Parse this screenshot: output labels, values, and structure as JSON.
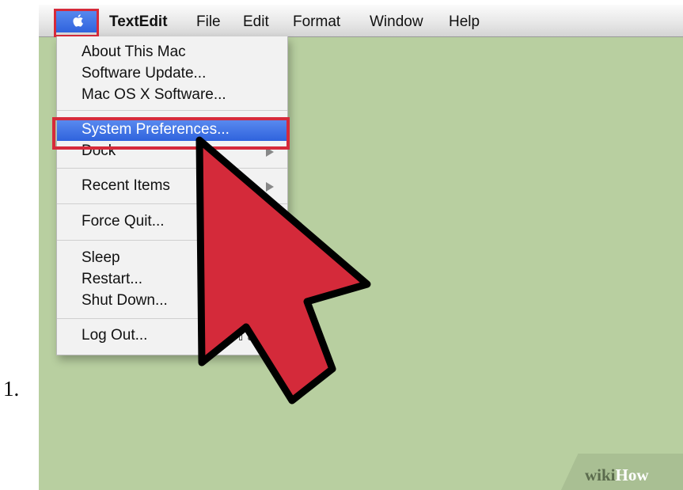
{
  "step_number": "1.",
  "menubar": {
    "apple_icon": "apple-logo-icon",
    "titles": [
      "TextEdit",
      "File",
      "Edit",
      "Format",
      "Window",
      "Help"
    ]
  },
  "apple_menu": {
    "items": [
      "About This Mac",
      "Software Update...",
      "Mac OS X Software...",
      "System Preferences...",
      "Dock",
      "Recent Items",
      "Force Quit...",
      "Sleep",
      "Restart...",
      "Shut Down...",
      "Log Out..."
    ],
    "selected": "System Preferences...",
    "logout_shortcut": "⇧⌘"
  },
  "annotations": {
    "highlight_color": "#d62a3a",
    "arrow_color": "#d42a3a"
  },
  "watermark": {
    "wiki": "wiki",
    "how": "How"
  },
  "colors": {
    "desktop": "#b8cfa0",
    "menu_highlight": "#3b6fe3"
  }
}
